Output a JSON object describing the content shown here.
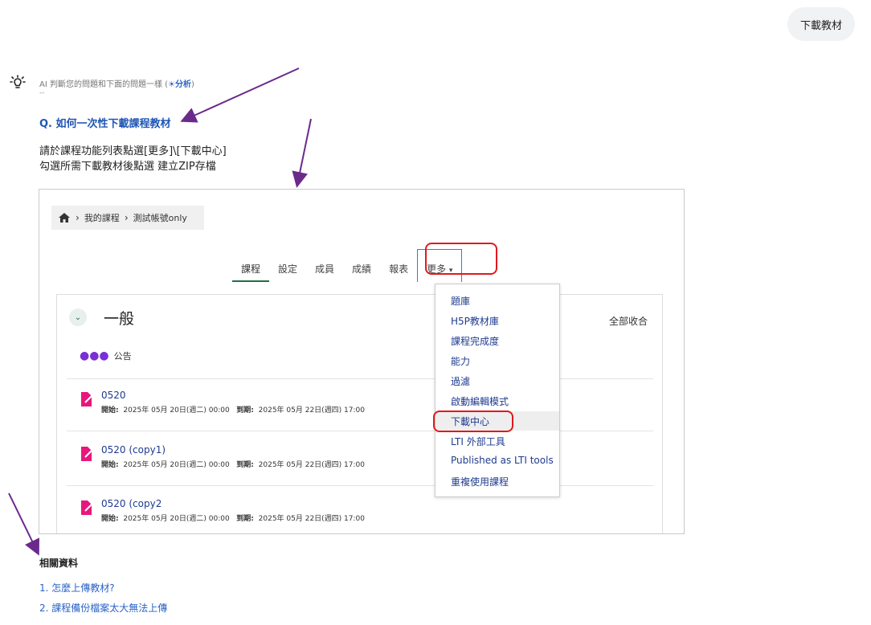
{
  "user_message": "下載教材",
  "ai_note": {
    "prefix": "AI 判斷您的問題和下面的問題一樣 (",
    "link": "分析",
    "suffix": ")",
    "dash": "--"
  },
  "question": "Q. 如何一次性下載課程教材",
  "answer": [
    "請於課程功能列表點選[更多]\\[下載中心]",
    "勾選所需下載教材後點選 建立ZIP存檔"
  ],
  "screenshot": {
    "breadcrumb": [
      "我的課程",
      "測試帳號only"
    ],
    "tabs": [
      "課程",
      "設定",
      "成員",
      "成績",
      "報表",
      "更多"
    ],
    "section_title": "一般",
    "collapse_all": "全部收合",
    "announcement": "公告",
    "activities": [
      {
        "title": "0520",
        "start_label": "開始:",
        "start": "2025年 05月 20日(週二) 00:00",
        "due_label": "到期:",
        "due": "2025年 05月 22日(週四) 17:00"
      },
      {
        "title": "0520 (copy1)",
        "start_label": "開始:",
        "start": "2025年 05月 20日(週二) 00:00",
        "due_label": "到期:",
        "due": "2025年 05月 22日(週四) 17:00"
      },
      {
        "title": "0520 (copy2",
        "start_label": "開始:",
        "start": "2025年 05月 20日(週二) 00:00",
        "due_label": "到期:",
        "due": "2025年 05月 22日(週四) 17:00"
      }
    ],
    "more_menu": [
      "題庫",
      "H5P教材庫",
      "課程完成度",
      "能力",
      "過濾",
      "啟動編輯模式",
      "下載中心",
      "LTI 外部工具",
      "Published as LTI tools",
      "重複使用課程"
    ],
    "highlighted_menu_item": "下載中心"
  },
  "related": {
    "title": "相關資料",
    "items": [
      "1. 怎麼上傳教材?",
      "2. 課程備份檔案太大無法上傳"
    ]
  },
  "colors": {
    "link": "#2a63c6",
    "menu_link": "#1f3b8f",
    "highlight": "#e0191e",
    "arrow": "#6a2a8c",
    "active_tab": "#1e6e47"
  }
}
